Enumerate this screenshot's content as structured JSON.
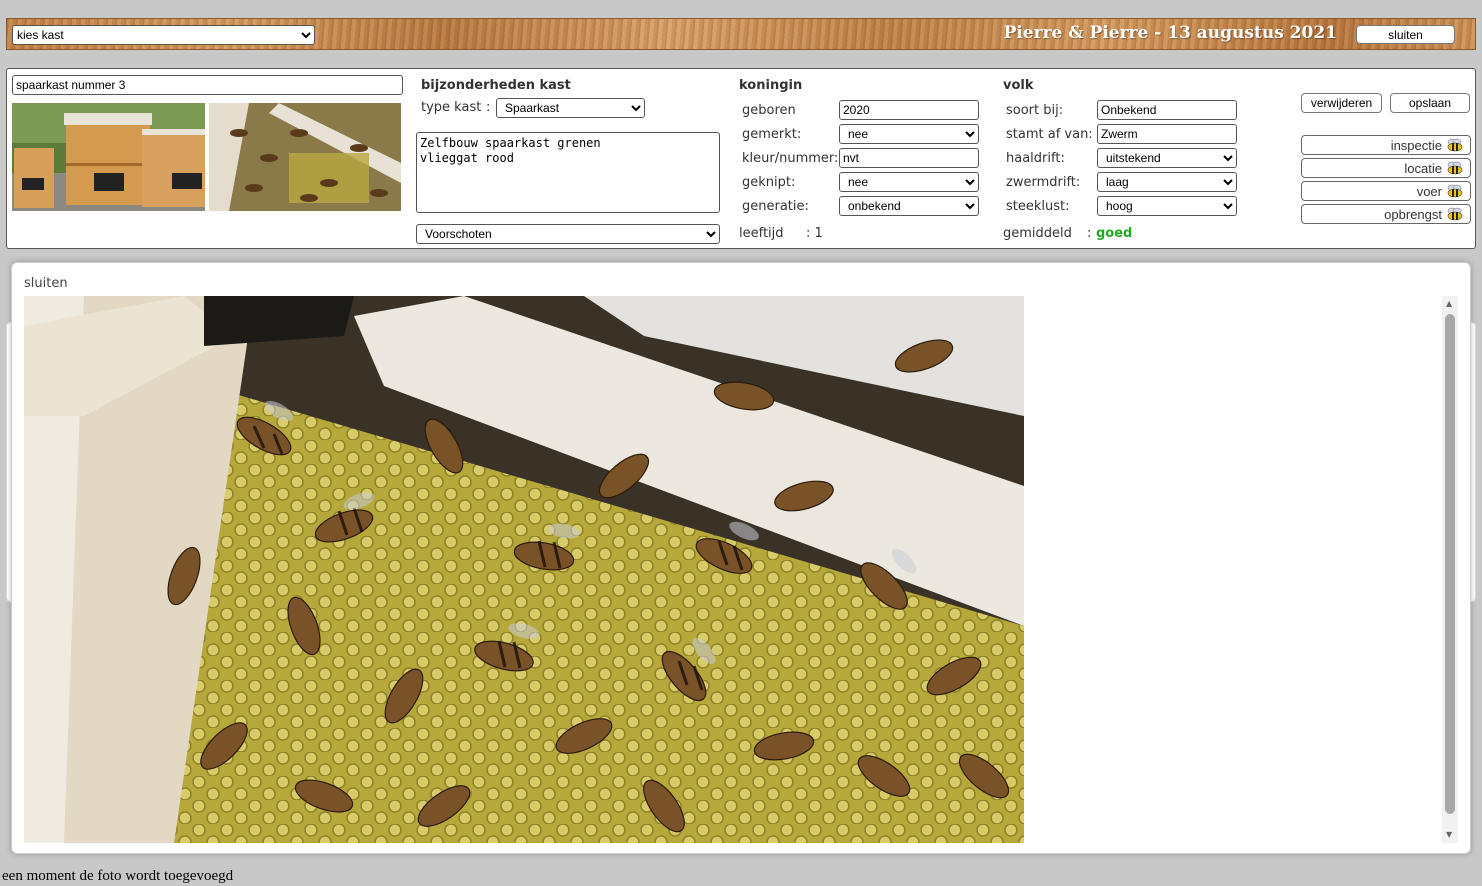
{
  "header": {
    "kies_kast_select": "kies kast",
    "title": "Pierre & Pierre - 13 augustus 2021",
    "sluiten_label": "sluiten"
  },
  "kast": {
    "name_value": "spaarkast nummer 3"
  },
  "details": {
    "heading": "bijzonderheden kast",
    "type_label": "type kast",
    "colon": ":",
    "type_value": "Spaarkast",
    "notes": "Zelfbouw spaarkast grenen\nvlieggat rood",
    "template_select": "Voorschoten"
  },
  "koningin": {
    "heading": "koningin",
    "geboren_label": "geboren",
    "geboren_value": "2020",
    "gemerkt_label": "gemerkt:",
    "gemerkt_value": "nee",
    "kleur_label": "kleur/nummer:",
    "kleur_value": "nvt",
    "geknipt_label": "geknipt:",
    "geknipt_value": "nee",
    "generatie_label": "generatie:",
    "generatie_value": "onbekend",
    "leeftijd_label": "leeftijd",
    "leeftijd_value": ": 1"
  },
  "volk": {
    "heading": "volk",
    "soort_label": "soort bij:",
    "soort_value": "Onbekend",
    "stamt_label": "stamt af van:",
    "stamt_value": "Zwerm",
    "haaldrift_label": "haaldrift:",
    "haaldrift_value": "uitstekend",
    "zwermdrift_label": "zwermdrift:",
    "zwermdrift_value": "laag",
    "steeklust_label": "steeklust:",
    "steeklust_value": "hoog",
    "gemiddeld_label": "gemiddeld",
    "gemiddeld_colon": ":",
    "gemiddeld_value": "goed"
  },
  "actions": {
    "verwijderen": "verwijderen",
    "opslaan": "opslaan",
    "inspectie": "inspectie",
    "locatie": "locatie",
    "voer": "voer",
    "opbrengst": "opbrengst"
  },
  "modal": {
    "close_label": "sluiten"
  },
  "status": {
    "message": "een moment de foto wordt toegevoegd"
  },
  "colors": {
    "good": "#22aa22",
    "wood": "#c48348"
  }
}
